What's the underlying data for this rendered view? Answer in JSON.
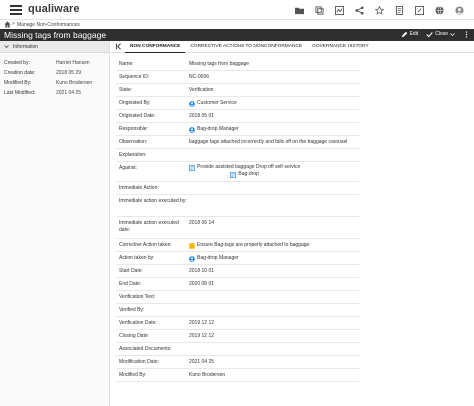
{
  "app": {
    "brand": "qualiware"
  },
  "breadcrumb": {
    "item": "Manage Non-Conformances"
  },
  "page": {
    "title": "Missing tags from baggage",
    "edit_label": "Edit",
    "close_label": "Close"
  },
  "info_panel": {
    "header": "Information",
    "rows": [
      {
        "label": "Created by:",
        "value": "Harriet Hansen"
      },
      {
        "label": "Creation date:",
        "value": "2018 05 29"
      },
      {
        "label": "Modified By:",
        "value": "Kuno Brodersen"
      },
      {
        "label": "Last Modified:",
        "value": "2021 04 25"
      }
    ]
  },
  "tabs": [
    {
      "label": "NON CONFORMANCE",
      "active": true
    },
    {
      "label": "CORRECTIVE ACTIONS TO NONCONFORMANCE",
      "active": false
    },
    {
      "label": "GOVERNANCE HISTORY",
      "active": false
    }
  ],
  "fields": [
    {
      "label": "Name:",
      "value": "Missing tags from baggage"
    },
    {
      "label": "Sequence ID:",
      "value": "NC-0006"
    },
    {
      "label": "State:",
      "value": "Verification"
    },
    {
      "label": "Originated By:",
      "value": "Customer Service",
      "icon": "person-icon"
    },
    {
      "label": "Originated Date:",
      "value": "2018 05 01"
    },
    {
      "label": "Responsible:",
      "value": "Bag-drop Manager",
      "icon": "person-icon"
    },
    {
      "label": "Observation:",
      "value": "baggage tags attached incorrectly and falls off on the baggage carousel"
    },
    {
      "label": "Explanation:",
      "value": ""
    },
    {
      "label": "Against:",
      "values": [
        {
          "text": "Provide assisted baggage Drop off self-service",
          "icon": "process-icon"
        },
        {
          "text": "Bag-drop",
          "icon": "process-icon"
        }
      ]
    },
    {
      "label": "Immediate Action:",
      "value": ""
    },
    {
      "label": "Immediate action executed by:",
      "value": ""
    },
    {
      "label": "Immediate action executed date:",
      "value": "2018 06 14"
    },
    {
      "label": "Corrective Action taken:",
      "value": "Ensure Bag-tags are properly attached to baggage",
      "icon": "action-icon"
    },
    {
      "label": "Action taken by:",
      "value": "Bag-drop Manager",
      "icon": "person-icon"
    },
    {
      "label": "Start Date:",
      "value": "2018 10 01"
    },
    {
      "label": "End Date:",
      "value": "2020 08 01"
    },
    {
      "label": "Verification Text:",
      "value": ""
    },
    {
      "label": "Verified By:",
      "value": ""
    },
    {
      "label": "Verification Date:",
      "value": "2019 12 12"
    },
    {
      "label": "Closing Date:",
      "value": "2019 12 12"
    },
    {
      "label": "Associated Documents:",
      "value": ""
    },
    {
      "label": "Modification Date:",
      "value": "2021 04 25"
    },
    {
      "label": "Modified By:",
      "value": "Kuno Brodersen"
    }
  ],
  "colors": {
    "title_bar": "#2f2f2f",
    "person_icon": "#1e88e5",
    "action_icon": "#f5b400",
    "process_icon": "#1e88e5"
  }
}
